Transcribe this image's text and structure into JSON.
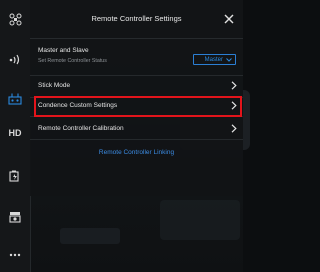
{
  "panel": {
    "title": "Remote Controller Settings",
    "close_icon": "close-icon"
  },
  "sidebar": {
    "items": [
      {
        "icon": "aircraft-settings-icon"
      },
      {
        "icon": "signal-icon"
      },
      {
        "icon": "remote-controller-icon",
        "active": true
      },
      {
        "icon": "hd-transmission-icon",
        "label": "HD"
      },
      {
        "icon": "battery-icon"
      },
      {
        "icon": "gimbal-camera-icon"
      },
      {
        "icon": "more-icon"
      }
    ]
  },
  "master_slave": {
    "label": "Master and Slave",
    "sublabel": "Set Remote Controller Status",
    "value": "Master"
  },
  "rows": {
    "stick_mode": "Stick Mode",
    "custom_settings": "Condence Custom Settings",
    "calibration": "Remote Controller Calibration"
  },
  "link": {
    "label": "Remote Controller Linking"
  },
  "colors": {
    "accent": "#2b8ae0",
    "highlight": "#e3141b",
    "panel_bg": "#121416"
  }
}
